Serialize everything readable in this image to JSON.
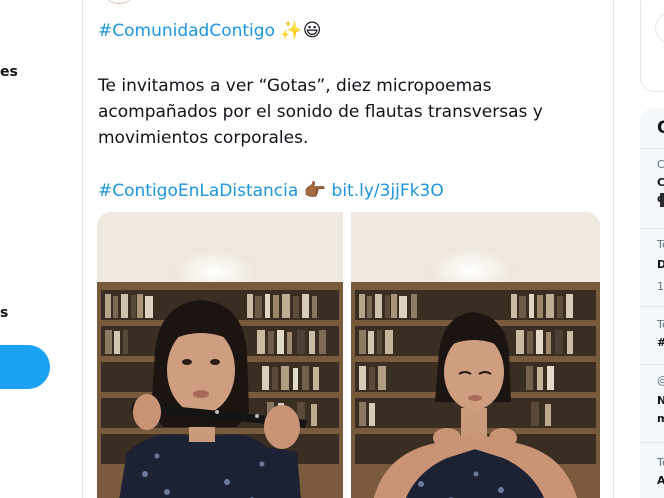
{
  "tweet": {
    "hashtag_line": "#ComunidadContigo",
    "hashtag_emoji": "✨😃",
    "body_lines": [
      "Te invitamos a ver “Gotas”, diez micropoemas",
      "acompañados por el sonido de flautas transversas y",
      "movimientos corporales."
    ],
    "hashtag2": "#ContigoEnLaDistancia",
    "pointing_emoji": "👉🏾",
    "link": "bit.ly/3jjFk3O"
  },
  "left_nav": {
    "frag_1": "es",
    "frag_2": "s"
  },
  "right_col": {
    "heading_frag": "Q",
    "items": [
      {
        "meta": "C",
        "line1": "C",
        "line2": "d"
      },
      {
        "meta": "Te",
        "line1": "D",
        "line2": "12"
      },
      {
        "meta": "Te",
        "line1": "#"
      },
      {
        "meta": "@",
        "line1": "N",
        "line2": "m"
      },
      {
        "meta": "Te",
        "line1": "A"
      }
    ]
  },
  "colors": {
    "link_blue": "#1b95e0",
    "brand_blue": "#1da1f2",
    "text": "#0f1419",
    "border": "#e1e8ed"
  }
}
